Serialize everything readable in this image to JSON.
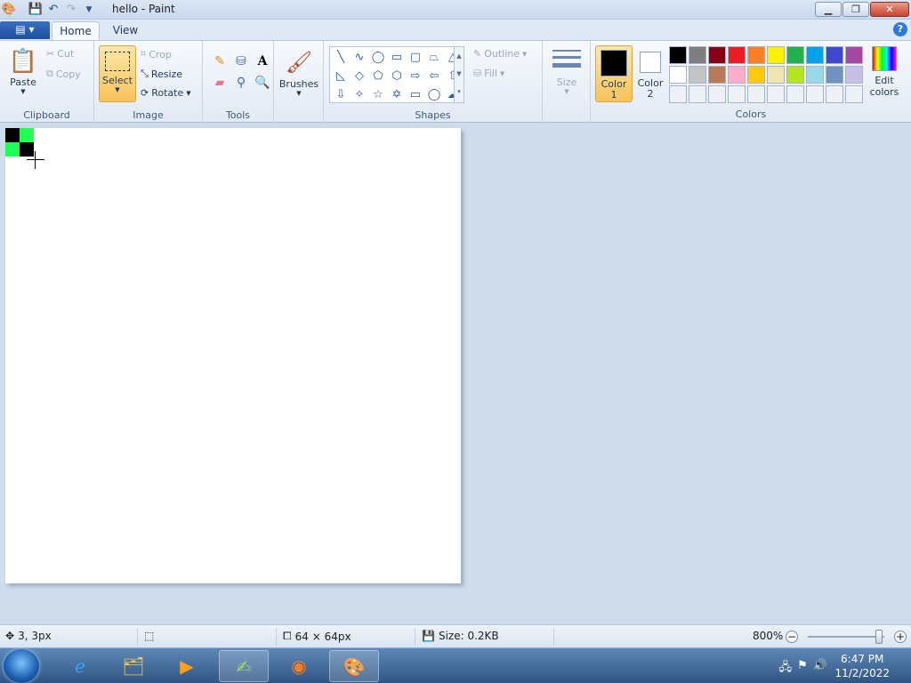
{
  "window": {
    "title": "hello - Paint"
  },
  "tabs": {
    "home": "Home",
    "view": "View"
  },
  "clipboard": {
    "paste": "Paste",
    "cut": "Cut",
    "copy": "Copy",
    "label": "Clipboard"
  },
  "image": {
    "select": "Select",
    "crop": "Crop",
    "resize": "Resize",
    "rotate": "Rotate",
    "label": "Image"
  },
  "tools": {
    "label": "Tools"
  },
  "brushes": {
    "label": "Brushes"
  },
  "shapes": {
    "outline": "Outline",
    "fill": "Fill",
    "label": "Shapes"
  },
  "size": {
    "label": "Size"
  },
  "colors": {
    "color1_label": "Color",
    "color1_num": "1",
    "color2_label": "Color",
    "color2_num": "2",
    "edit_line1": "Edit",
    "edit_line2": "colors",
    "label": "Colors",
    "color1_value": "#000000",
    "color2_value": "#ffffff",
    "palette_row1": [
      "#000000",
      "#7f7f7f",
      "#880015",
      "#ed1c24",
      "#ff7f27",
      "#fff200",
      "#22b14c",
      "#00a2e8",
      "#3f48cc",
      "#a349a4"
    ],
    "palette_row2": [
      "#ffffff",
      "#c3c3c3",
      "#b97a57",
      "#ffaec9",
      "#ffc90e",
      "#efe4b0",
      "#b5e61d",
      "#99d9ea",
      "#7092be",
      "#c8bfe7"
    ]
  },
  "canvas_pixels": {
    "dark": "#000000",
    "green": "#22ff55"
  },
  "status": {
    "cursor_pos": "3, 3px",
    "image_size": "64 × 64px",
    "file_size": "Size: 0.2KB",
    "zoom": "800%"
  },
  "taskbar": {
    "time": "6:47 PM",
    "date": "11/2/2022"
  }
}
